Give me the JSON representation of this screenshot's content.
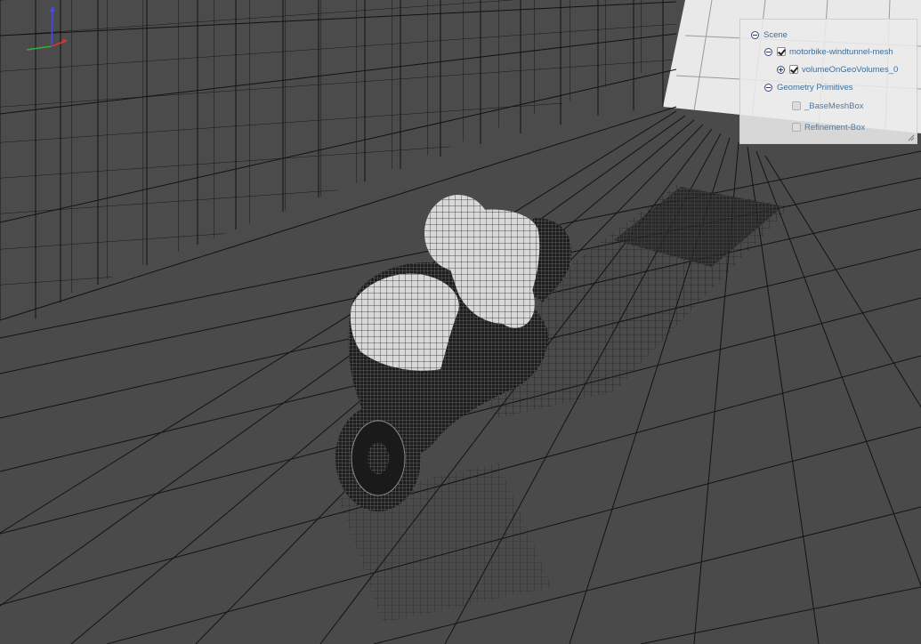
{
  "scene_tree": {
    "root": {
      "label": "Scene",
      "expanded": true
    },
    "items": [
      {
        "label": "motorbike-windtunnel-mesh",
        "checked": true,
        "toggle": "minus"
      },
      {
        "label": "volumeOnGeoVolumes_0",
        "checked": true,
        "toggle": "plus"
      },
      {
        "label": "Geometry Primitives",
        "toggle": "minus"
      },
      {
        "label": "_BaseMeshBox",
        "checked": false
      },
      {
        "label": "Refinement-Box",
        "checked": false
      }
    ]
  },
  "axes_gizmo": {
    "x_color": "#e03030",
    "y_color": "#30b030",
    "z_color": "#4a4ae0"
  },
  "colors": {
    "background": "#4a4a4a",
    "grid_line": "#111111",
    "mesh": "#e0e0e0",
    "panel": "#ebebeb",
    "label": "#3d6d9a"
  }
}
